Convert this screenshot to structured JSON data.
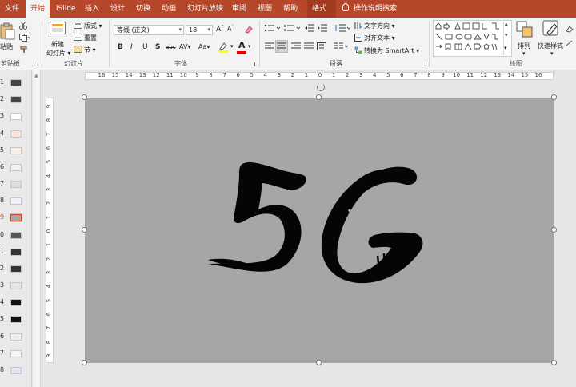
{
  "tabs": [
    {
      "label": "文件",
      "active": false
    },
    {
      "label": "开始",
      "active": true
    },
    {
      "label": "iSlide",
      "active": false
    },
    {
      "label": "插入",
      "active": false
    },
    {
      "label": "设计",
      "active": false
    },
    {
      "label": "切换",
      "active": false
    },
    {
      "label": "动画",
      "active": false
    },
    {
      "label": "幻灯片放映",
      "active": false
    },
    {
      "label": "审阅",
      "active": false
    },
    {
      "label": "视图",
      "active": false
    },
    {
      "label": "帮助",
      "active": false
    },
    {
      "label": "格式",
      "active": false
    }
  ],
  "tell_me": "操作说明搜索",
  "clipboard": {
    "paste": "粘贴",
    "group": "剪贴板"
  },
  "slides": {
    "new_slide": "新建",
    "new_slide2": "幻灯片",
    "layout": "版式",
    "reset": "重置",
    "section": "节",
    "group": "幻灯片"
  },
  "font": {
    "name": "等线 (正文)",
    "size": "18",
    "bold": "B",
    "italic": "I",
    "underline": "U",
    "shadow": "S",
    "strike": "abc",
    "spacing": "AV",
    "case": "Aa",
    "group": "字体"
  },
  "paragraph": {
    "text_direction": "文字方向",
    "align_text": "对齐文本",
    "smartart": "转换为 SmartArt",
    "group": "段落"
  },
  "drawing": {
    "arrange": "排列",
    "quick_styles": "快速样式",
    "group": "绘图"
  },
  "thumbnails": [
    {
      "num": "1"
    },
    {
      "num": "2"
    },
    {
      "num": "3"
    },
    {
      "num": "4"
    },
    {
      "num": "5"
    },
    {
      "num": "6"
    },
    {
      "num": "7"
    },
    {
      "num": "8"
    },
    {
      "num": "9",
      "selected": true
    },
    {
      "num": "0"
    },
    {
      "num": "1"
    },
    {
      "num": "2"
    },
    {
      "num": "3"
    },
    {
      "num": "4"
    },
    {
      "num": "5"
    },
    {
      "num": "6"
    },
    {
      "num": "7"
    },
    {
      "num": "8"
    }
  ],
  "ruler_h": [
    "16",
    "15",
    "14",
    "13",
    "12",
    "11",
    "10",
    "9",
    "8",
    "7",
    "6",
    "5",
    "4",
    "3",
    "2",
    "1",
    "0",
    "1",
    "2",
    "3",
    "4",
    "5",
    "6",
    "7",
    "8",
    "9",
    "10",
    "11",
    "12",
    "13",
    "14",
    "15",
    "16"
  ],
  "ruler_v": [
    "9",
    "8",
    "7",
    "6",
    "5",
    "4",
    "3",
    "2",
    "1",
    "0",
    "1",
    "2",
    "3",
    "4",
    "5",
    "6",
    "7",
    "8",
    "9"
  ],
  "slide": {
    "text": "5G",
    "background": "#a6a6a6"
  },
  "colors": {
    "accent": "#b7472a",
    "ribbon": "#f3f3f3"
  }
}
